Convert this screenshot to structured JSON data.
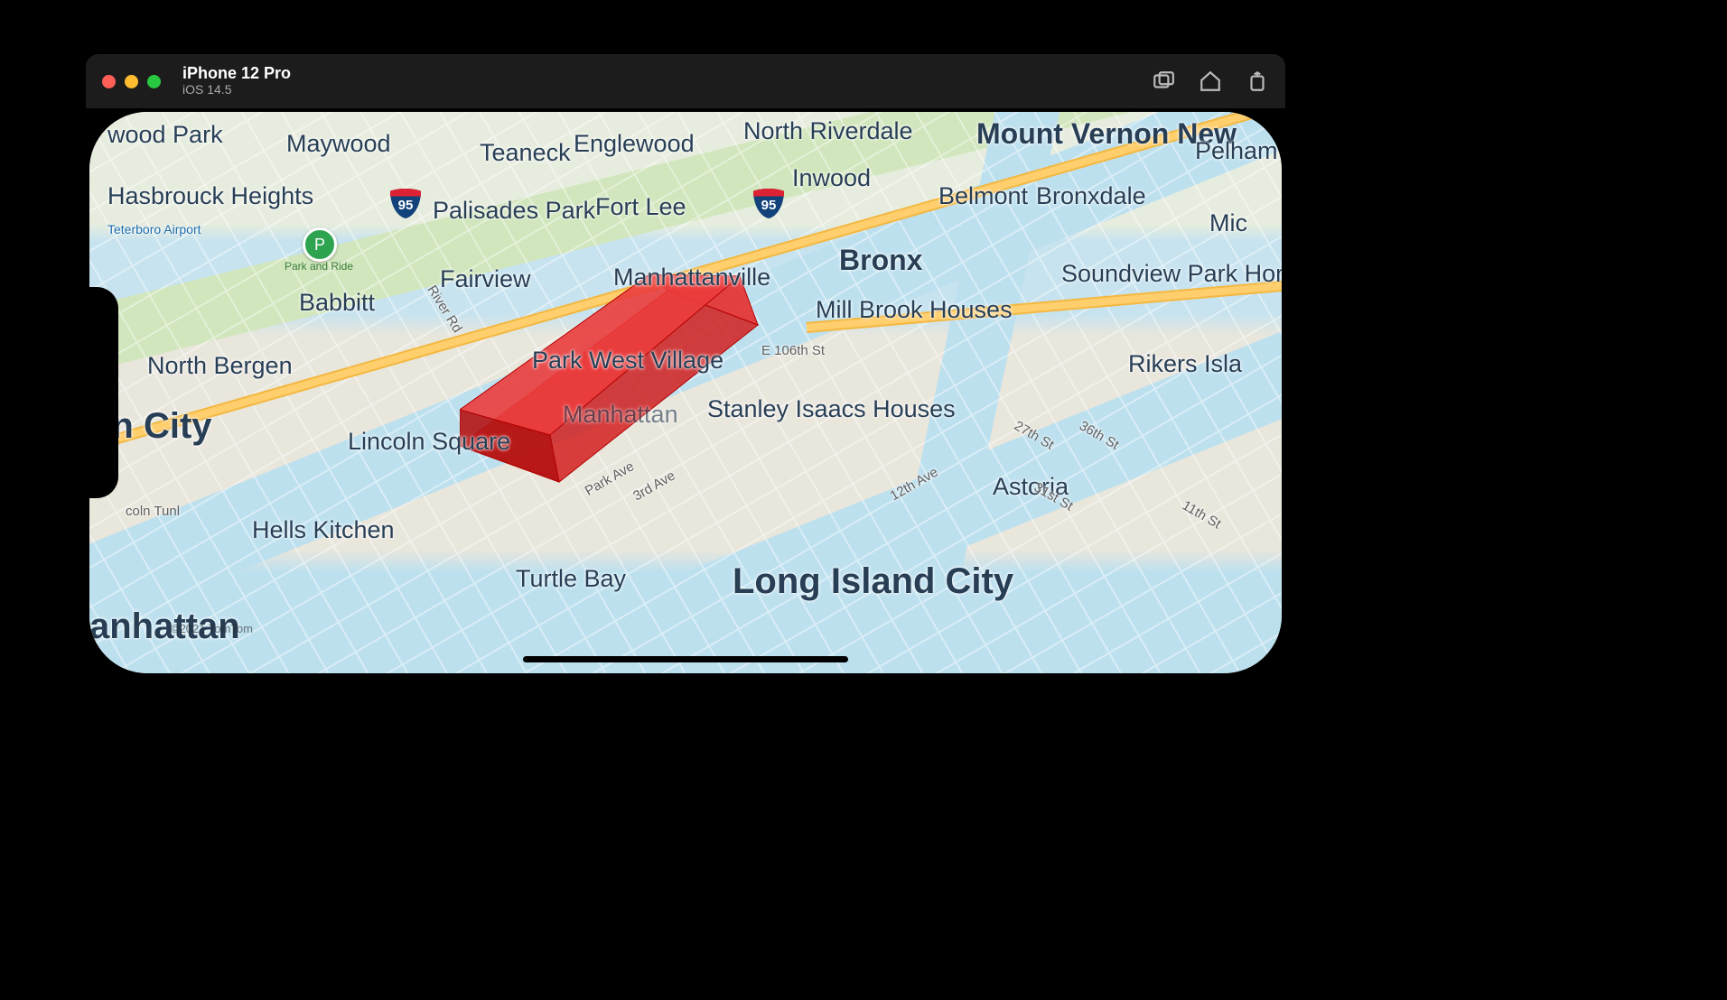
{
  "window": {
    "device_title": "iPhone 12 Pro",
    "os_title": "iOS 14.5"
  },
  "shields": {
    "i95a": "95",
    "i95b": "95"
  },
  "poi": {
    "park_and_ride": "Park and Ride"
  },
  "airport": {
    "teterboro": "Teterboro Airport"
  },
  "cities": {
    "long_island_city": "Long Island City",
    "bronx": "Bronx",
    "union_city_partial": "on City",
    "manhattan_partial": "anhattan",
    "mount_vernon_partial": "Mount Vernon New"
  },
  "labels": {
    "wood_park": "wood Park",
    "maywood": "Maywood",
    "teaneck": "Teaneck",
    "englewood": "Englewood",
    "north_riverdale": "North Riverdale",
    "inwood": "Inwood",
    "belmont": "Belmont",
    "bronxdale": "Bronxdale",
    "pelham": "Pelham",
    "hasbrouck_heights": "Hasbrouck Heights",
    "palisades_park": "Palisades Park",
    "fort_lee": "Fort Lee",
    "fairview": "Fairview",
    "manhattanville": "Manhattanville",
    "mill_brook": "Mill Brook Houses",
    "soundview": "Soundview Park Homes",
    "babbitt": "Babbitt",
    "mic_partial": "Mic",
    "north_bergen": "North Bergen",
    "park_west_village": "Park West Village",
    "e106": "E 106th St",
    "rikers": "Rikers Isla",
    "lincoln_square": "Lincoln Square",
    "manhattan_ctr": "Manhattan",
    "stanley_isaacs": "Stanley Isaacs Houses",
    "astoria": "Astoria",
    "hells_kitchen": "Hells Kitchen",
    "turtle_bay": "Turtle Bay",
    "lincoln_tunnel": "coln Tunl",
    "river_rd": "River Rd",
    "park_ave": "Park Ave",
    "third_ave": "3rd Ave",
    "twelfth_ave": "12th Ave",
    "twentyseventh": "27th St",
    "thirtysixth": "36th St",
    "thirtyfirst": "31st St",
    "eleventh": "11th St"
  },
  "attribution": "©2021 TomTom"
}
